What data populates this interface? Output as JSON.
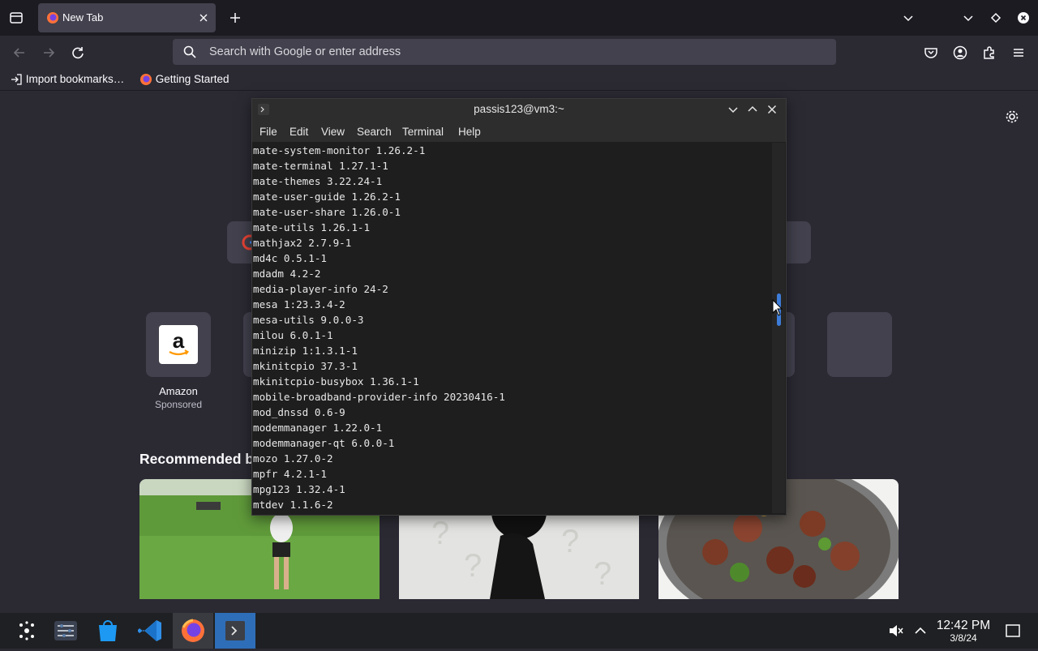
{
  "browser": {
    "tab": {
      "title": "New Tab"
    },
    "urlbar": {
      "placeholder": "Search with Google or enter address"
    },
    "bookmarks": [
      {
        "label": "Import bookmarks…"
      },
      {
        "label": "Getting Started"
      }
    ]
  },
  "newtab": {
    "top_site": {
      "label": "Amazon",
      "sublabel": "Sponsored"
    },
    "recommended_title": "Recommended b"
  },
  "terminal": {
    "title": "passis123@vm3:~",
    "menu": [
      "File",
      "Edit",
      "View",
      "Search",
      "Terminal",
      "Help"
    ],
    "lines": [
      "mate-system-monitor 1.26.2-1",
      "mate-terminal 1.27.1-1",
      "mate-themes 3.22.24-1",
      "mate-user-guide 1.26.2-1",
      "mate-user-share 1.26.0-1",
      "mate-utils 1.26.1-1",
      "mathjax2 2.7.9-1",
      "md4c 0.5.1-1",
      "mdadm 4.2-2",
      "media-player-info 24-2",
      "mesa 1:23.3.4-2",
      "mesa-utils 9.0.0-3",
      "milou 6.0.1-1",
      "minizip 1:1.3.1-1",
      "mkinitcpio 37.3-1",
      "mkinitcpio-busybox 1.36.1-1",
      "mobile-broadband-provider-info 20230416-1",
      "mod_dnssd 0.6-9",
      "modemmanager 1.22.0-1",
      "modemmanager-qt 6.0.0-1",
      "mozo 1.27.0-2",
      "mpfr 4.2.1-1",
      "mpg123 1.32.4-1",
      "mtdev 1.1.6-2"
    ]
  },
  "taskbar": {
    "time": "12:42 PM",
    "date": "3/8/24"
  },
  "colors": {
    "accent_blue": "#3d7cd8",
    "firefox_orange": "#ff7139",
    "taskbar_bg": "#1f2023"
  }
}
